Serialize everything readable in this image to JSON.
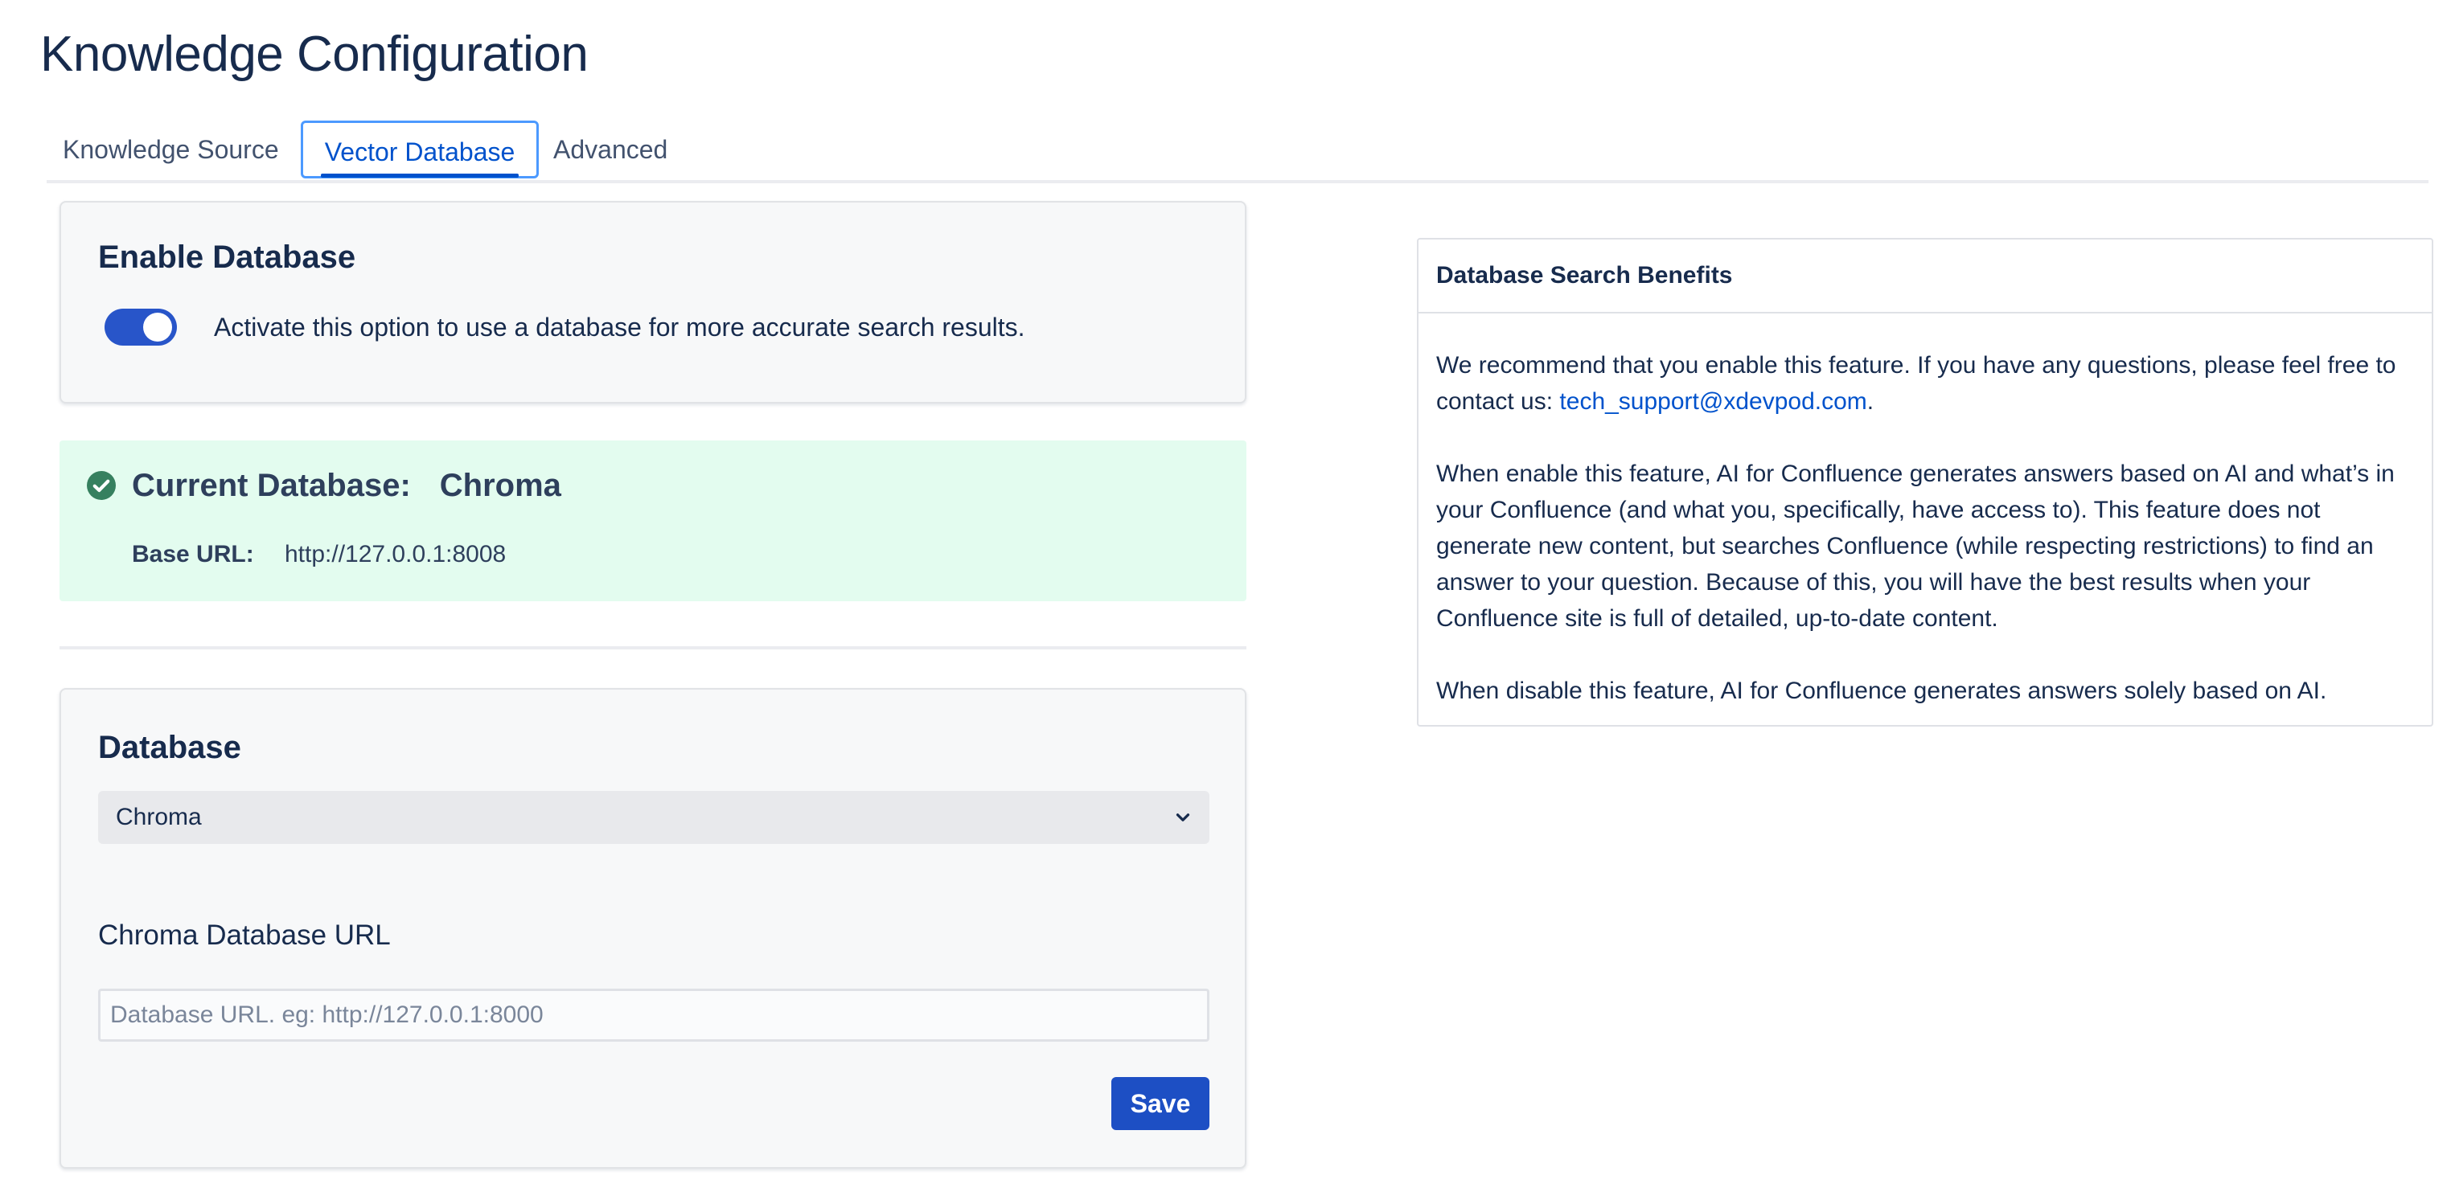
{
  "page": {
    "title": "Knowledge Configuration"
  },
  "tabs": [
    {
      "label": "Knowledge Source"
    },
    {
      "label": "Vector Database",
      "active": true
    },
    {
      "label": "Advanced"
    }
  ],
  "enable_card": {
    "title": "Enable Database",
    "toggle_on": true,
    "toggle_label": "Activate this option to use a database for more accurate search results."
  },
  "status": {
    "icon": "check-circle-icon",
    "title_label": "Current Database:",
    "title_value": "Chroma",
    "base_url_label": "Base URL:",
    "base_url_value": "http://127.0.0.1:8008"
  },
  "database_card": {
    "title": "Database",
    "selected": "Chroma",
    "url_label": "Chroma Database URL",
    "url_value": "",
    "url_placeholder": "Database URL. eg: http://127.0.0.1:8000",
    "save_label": "Save"
  },
  "benefits": {
    "title": "Database Search Benefits",
    "p1_text": "We recommend that you enable this feature. If you have any questions, please feel free to contact us: ",
    "p1_email": "tech_support@xdevpod.com",
    "p1_end": ".",
    "p2": "When enable this feature, AI for Confluence generates answers based on AI and what’s in your Confluence (and what you, specifically, have access to). This feature does not generate new content, but searches Confluence (while respecting restrictions) to find an answer to your question. Because of this, you will have the best results when your Confluence site is full of detailed, up-to-date content.",
    "p3": "When disable this feature, AI for Confluence generates answers solely based on AI."
  },
  "colors": {
    "primary": "#1d4fc4",
    "link": "#0052cc",
    "success_bg": "#e3fcef",
    "success_icon": "#36805f",
    "text": "#172b4d"
  }
}
